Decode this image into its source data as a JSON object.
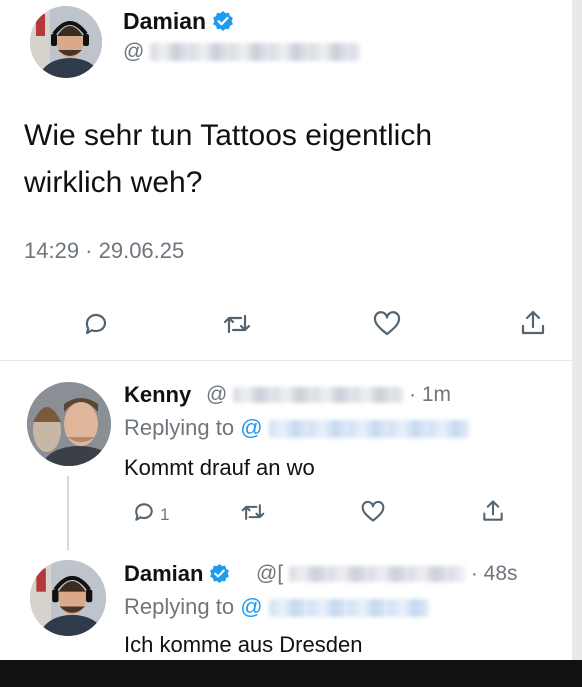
{
  "main_tweet": {
    "author_name": "Damian",
    "handle_prefix": "@",
    "text_line1": "Wie sehr tun Tattoos eigentlich",
    "text_line2": "wirklich weh?",
    "timestamp": "14:29 · 29.06.25"
  },
  "reply1": {
    "author_name": "Kenny",
    "handle_prefix": "@",
    "time": "· 1m",
    "replying_label": "Replying to",
    "replying_prefix": "@",
    "text": "Kommt drauf an wo",
    "reply_count": "1"
  },
  "reply2": {
    "author_name": "Damian",
    "handle_prefix": "@[",
    "time": "· 48s",
    "replying_label": "Replying to",
    "replying_prefix": "@",
    "text": "Ich komme aus Dresden"
  },
  "colors": {
    "accent": "#1d9bf0",
    "verified": "#1d9bf0",
    "secondary_text": "#6e767d"
  },
  "icons": {
    "reply": "reply-icon",
    "retweet": "retweet-icon",
    "like": "heart-icon",
    "share": "share-icon",
    "verified": "verified-badge-icon"
  }
}
